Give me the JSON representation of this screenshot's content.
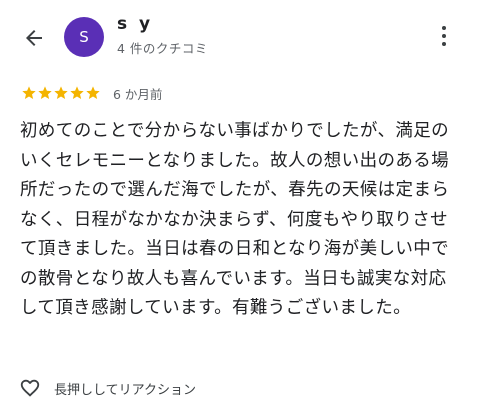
{
  "header": {
    "back_icon": "arrow-left-icon",
    "avatar_initial": "S",
    "avatar_color": "#5a2fb6",
    "user_name": "s y",
    "review_count": "4 件のクチコミ",
    "more_icon": "more-vertical-icon"
  },
  "review": {
    "rating": 5,
    "rating_max": 5,
    "star_color": "#f4b400",
    "time_ago": "6 か月前",
    "text": "初めてのことで分からない事ばかりでしたが、満足のいくセレモニーとなりました。故人の想い出のある場所だったので選んだ海でしたが、春先の天候は定まらなく、日程がなかなか決まらず、何度もやり取りさせて頂きました。当日は春の日和となり海が美しい中での散骨となり故人も喜んでいます。当日も誠実な対応して頂き感謝しています。有難うございました。"
  },
  "reaction": {
    "icon": "heart-icon",
    "label": "長押ししてリアクション"
  }
}
